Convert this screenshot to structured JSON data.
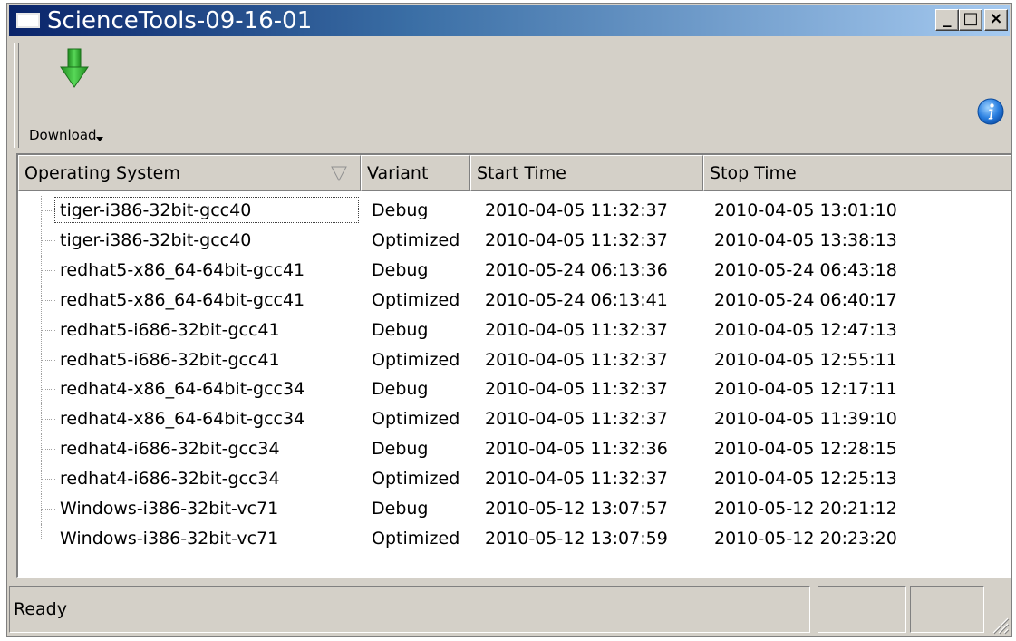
{
  "window": {
    "title": "ScienceTools-09-16-01",
    "controls": {
      "minimize": "_",
      "maximize": "□",
      "close": "×"
    }
  },
  "toolbar": {
    "download": {
      "label": "Download",
      "icon": "green-down-arrow-icon"
    },
    "info": {
      "icon": "info-icon"
    }
  },
  "table": {
    "columns": [
      "Operating System",
      "Variant",
      "Start Time",
      "Stop Time"
    ],
    "rows": [
      [
        "tiger-i386-32bit-gcc40",
        "Debug",
        "2010-04-05 11:32:37",
        "2010-04-05 13:01:10"
      ],
      [
        "tiger-i386-32bit-gcc40",
        "Optimized",
        "2010-04-05 11:32:37",
        "2010-04-05 13:38:13"
      ],
      [
        "redhat5-x86_64-64bit-gcc41",
        "Debug",
        "2010-05-24 06:13:36",
        "2010-05-24 06:43:18"
      ],
      [
        "redhat5-x86_64-64bit-gcc41",
        "Optimized",
        "2010-05-24 06:13:41",
        "2010-05-24 06:40:17"
      ],
      [
        "redhat5-i686-32bit-gcc41",
        "Debug",
        "2010-04-05 11:32:37",
        "2010-04-05 12:47:13"
      ],
      [
        "redhat5-i686-32bit-gcc41",
        "Optimized",
        "2010-04-05 11:32:37",
        "2010-04-05 12:55:11"
      ],
      [
        "redhat4-x86_64-64bit-gcc34",
        "Debug",
        "2010-04-05 11:32:37",
        "2010-04-05 12:17:11"
      ],
      [
        "redhat4-x86_64-64bit-gcc34",
        "Optimized",
        "2010-04-05 11:32:37",
        "2010-04-05 11:39:10"
      ],
      [
        "redhat4-i686-32bit-gcc34",
        "Debug",
        "2010-04-05 11:32:36",
        "2010-04-05 12:28:15"
      ],
      [
        "redhat4-i686-32bit-gcc34",
        "Optimized",
        "2010-04-05 11:32:37",
        "2010-04-05 12:25:13"
      ],
      [
        "Windows-i386-32bit-vc71",
        "Debug",
        "2010-05-12 13:07:57",
        "2010-05-12 20:21:12"
      ],
      [
        "Windows-i386-32bit-vc71",
        "Optimized",
        "2010-05-12 13:07:59",
        "2010-05-12 20:23:20"
      ]
    ]
  },
  "status": {
    "text": "Ready"
  },
  "colors": {
    "title_start": "#0a246a",
    "title_end": "#a6caf0",
    "face": "#d4d0c8"
  }
}
